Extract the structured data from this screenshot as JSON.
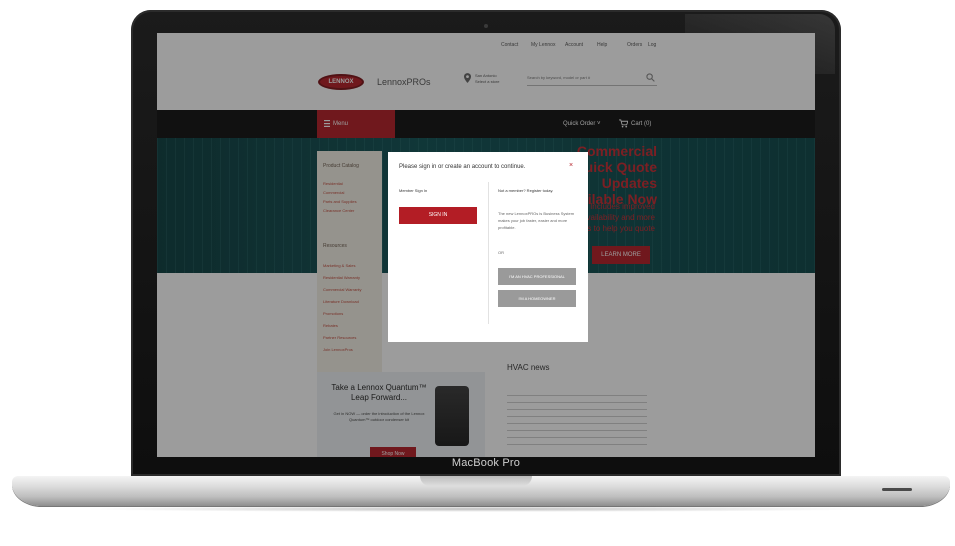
{
  "device": {
    "brand_label": "MacBook Pro"
  },
  "site": {
    "utility_links": [
      "Contact",
      "My Lennox",
      "Account",
      "Help",
      "Orders",
      "Log"
    ],
    "logo_text": "LENNOX",
    "product_name": "LennoxPROs",
    "location": {
      "line1": "San Antonio",
      "line2": "Select a store"
    },
    "search_placeholder": "Search by keyword, model or part #",
    "nav": {
      "menu_label": "Menu",
      "quick_order": "Quick Order",
      "cart": "Cart (0)"
    },
    "hero": {
      "title": "Commercial Quick Quote Updates Available Now",
      "body": "Includes improved availability and more options to help you quote",
      "cta": "LEARN MORE"
    },
    "sidebar": {
      "heading_1": "Product Catalog",
      "links_1": [
        "Residential",
        "Commercial",
        "Parts and Supplies",
        "Clearance Center"
      ],
      "heading_2": "Resources",
      "links_2": [
        "Marketing & Sales",
        "Residential Warranty",
        "Commercial Warranty",
        "Literature Download",
        "Promotions",
        "Rebates",
        "Partner Resources",
        "Join LennoxPros"
      ]
    },
    "news": {
      "title": "HVAC news"
    },
    "promo": {
      "title": "Take a Lennox Quantum™ Leap Forward...",
      "subtitle": "Get in NOW — order the introduction of the Lennox Quantum™ outdoor condenser kit",
      "button": "Shop Now"
    }
  },
  "modal": {
    "title": "Please sign in or create an account to continue.",
    "close": "×",
    "member": {
      "heading": "Member Sign In",
      "button": "SIGN IN"
    },
    "register": {
      "heading": "Not a member? Register today.",
      "body": "The new LennoxPROs is Business System makes your job faster, easier and more profitable.",
      "or": "OR",
      "pro_button": "I'M AN HVAC PROFESSIONAL",
      "homeowner_button": "I'M A HOMEOWNER"
    }
  }
}
